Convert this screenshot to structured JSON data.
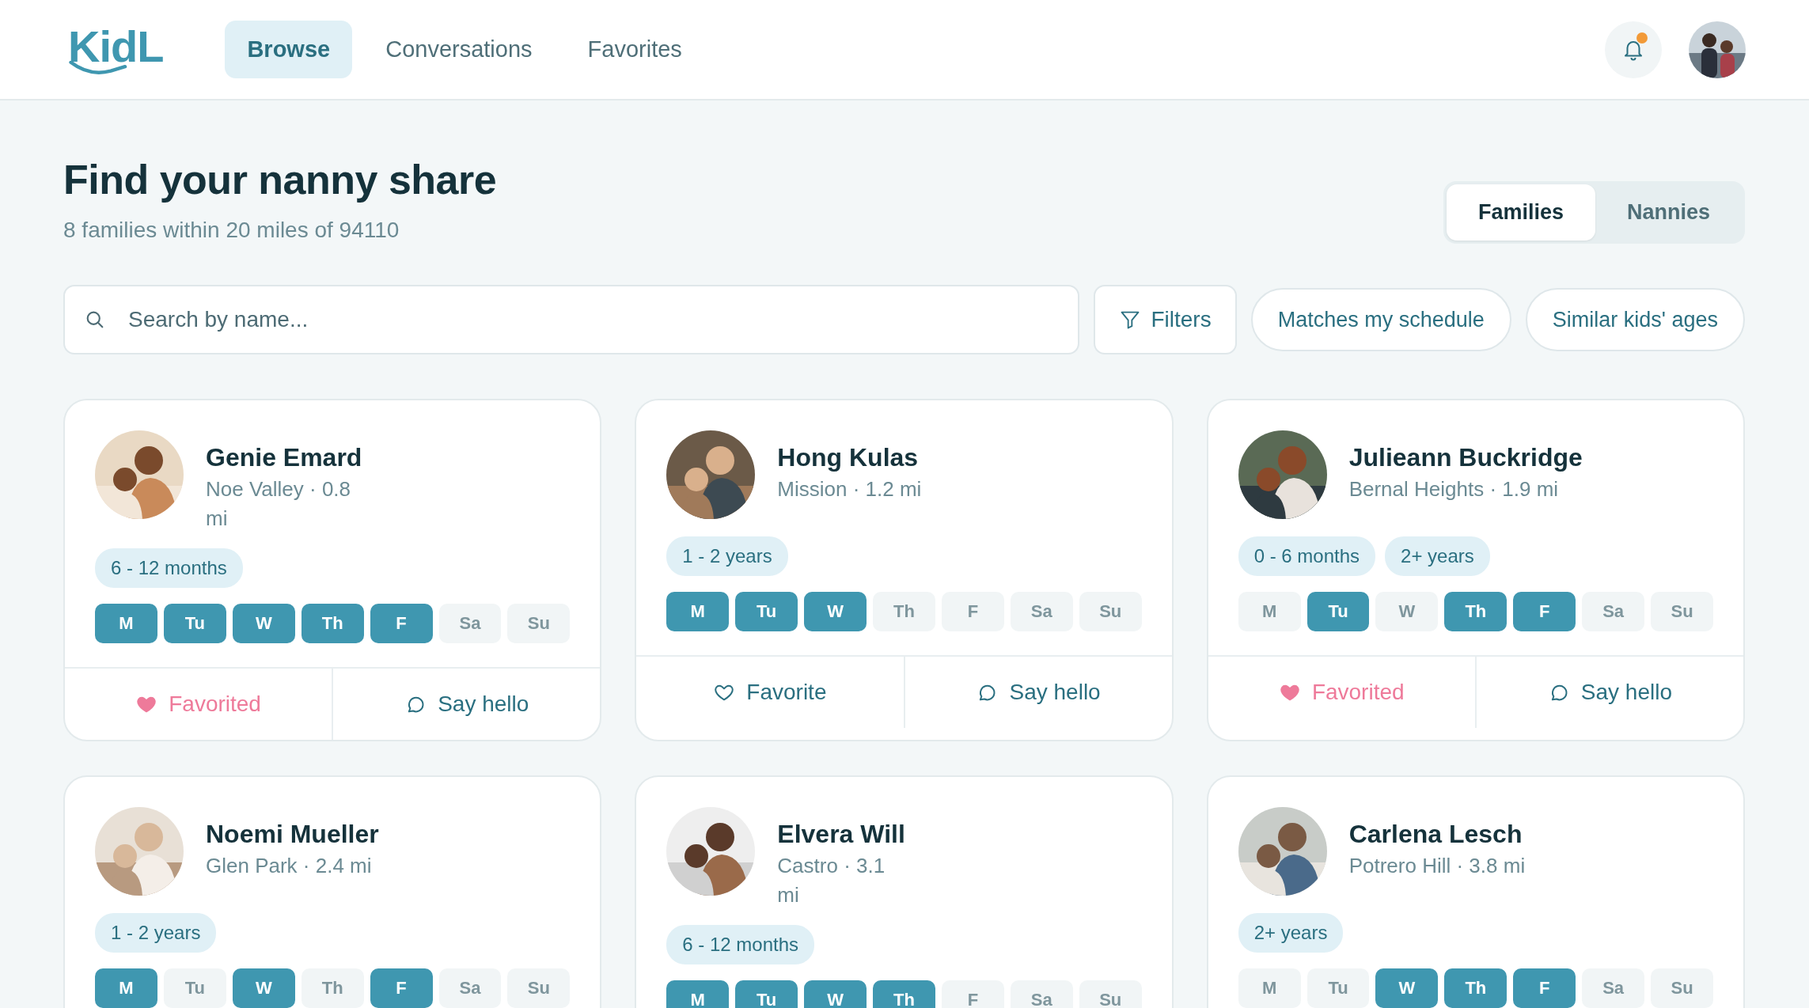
{
  "nav": {
    "logo": "KidL",
    "tabs": [
      {
        "label": "Browse",
        "selected": true
      },
      {
        "label": "Conversations",
        "selected": false
      },
      {
        "label": "Favorites",
        "selected": false
      }
    ],
    "notifications_unread": true
  },
  "header": {
    "title": "Find your nanny share",
    "subtitle": "8 families within 20 miles of 94110",
    "toggle": [
      {
        "label": "Families",
        "selected": true
      },
      {
        "label": "Nannies",
        "selected": false
      }
    ]
  },
  "search": {
    "placeholder": "Search by name..."
  },
  "filters": [
    {
      "kind": "filter",
      "label": "Filters"
    },
    {
      "kind": "chip",
      "label": "Matches my schedule"
    },
    {
      "kind": "chip",
      "label": "Similar kids' ages"
    }
  ],
  "families": [
    {
      "name": "Genie Emard",
      "location_lines": [
        "Noe Valley · 0.8",
        "mi"
      ],
      "ages": [
        "6 - 12 months"
      ],
      "days": [
        {
          "label": "M",
          "on": true
        },
        {
          "label": "Tu",
          "on": true
        },
        {
          "label": "W",
          "on": true
        },
        {
          "label": "Th",
          "on": true
        },
        {
          "label": "F",
          "on": true
        },
        {
          "label": "Sa",
          "on": false
        },
        {
          "label": "Su",
          "on": false
        }
      ],
      "favorite": {
        "label": "Favorited",
        "on": true
      },
      "hello": "Say hello"
    },
    {
      "name": "Hong Kulas",
      "location_lines": [
        "Mission · 1.2 mi"
      ],
      "ages": [
        "1 - 2 years"
      ],
      "days": [
        {
          "label": "M",
          "on": true
        },
        {
          "label": "Tu",
          "on": true
        },
        {
          "label": "W",
          "on": true
        },
        {
          "label": "Th",
          "on": false
        },
        {
          "label": "F",
          "on": false
        },
        {
          "label": "Sa",
          "on": false
        },
        {
          "label": "Su",
          "on": false
        }
      ],
      "favorite": {
        "label": "Favorite",
        "on": false
      },
      "hello": "Say hello"
    },
    {
      "name": "Julieann Buckridge",
      "location_lines": [
        "Bernal Heights · 1.9 mi"
      ],
      "ages": [
        "0 - 6 months",
        "2+ years"
      ],
      "days": [
        {
          "label": "M",
          "on": false
        },
        {
          "label": "Tu",
          "on": true
        },
        {
          "label": "W",
          "on": false
        },
        {
          "label": "Th",
          "on": true
        },
        {
          "label": "F",
          "on": true
        },
        {
          "label": "Sa",
          "on": false
        },
        {
          "label": "Su",
          "on": false
        }
      ],
      "favorite": {
        "label": "Favorited",
        "on": true
      },
      "hello": "Say hello"
    },
    {
      "name": "Noemi Mueller",
      "location_lines": [
        "Glen Park · 2.4 mi"
      ],
      "ages": [
        "1 - 2 years"
      ],
      "days": [
        {
          "label": "M",
          "on": true
        },
        {
          "label": "Tu",
          "on": false
        },
        {
          "label": "W",
          "on": true
        },
        {
          "label": "Th",
          "on": false
        },
        {
          "label": "F",
          "on": true
        },
        {
          "label": "Sa",
          "on": false
        },
        {
          "label": "Su",
          "on": false
        }
      ]
    },
    {
      "name": "Elvera Will",
      "location_lines": [
        "Castro · 3.1",
        "mi"
      ],
      "ages": [
        "6 - 12 months"
      ],
      "days": [
        {
          "label": "M",
          "on": true
        },
        {
          "label": "Tu",
          "on": true
        },
        {
          "label": "W",
          "on": true
        },
        {
          "label": "Th",
          "on": true
        },
        {
          "label": "F",
          "on": false
        },
        {
          "label": "Sa",
          "on": false
        },
        {
          "label": "Su",
          "on": false
        }
      ]
    },
    {
      "name": "Carlena Lesch",
      "location_lines": [
        "Potrero Hill · 3.8 mi"
      ],
      "ages": [
        "2+ years"
      ],
      "days": [
        {
          "label": "M",
          "on": false
        },
        {
          "label": "Tu",
          "on": false
        },
        {
          "label": "W",
          "on": true
        },
        {
          "label": "Th",
          "on": true
        },
        {
          "label": "F",
          "on": true
        },
        {
          "label": "Sa",
          "on": false
        },
        {
          "label": "Su",
          "on": false
        }
      ]
    }
  ]
}
